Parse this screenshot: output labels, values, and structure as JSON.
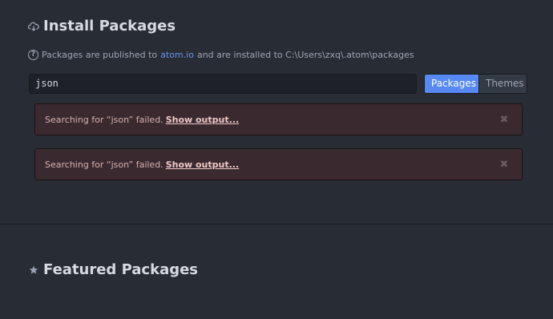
{
  "install": {
    "title": "Install Packages",
    "title_icon": "cloud-download-icon",
    "info_prefix": "Packages are published to",
    "info_link": "atom.io",
    "info_suffix": "and are installed to C:\\Users\\zxq\\.atom\\packages",
    "search_value": "json",
    "buttons": {
      "packages": "Packages",
      "themes": "Themes"
    },
    "alerts": [
      {
        "message": "Searching for “json” failed.",
        "action": "Show output..."
      },
      {
        "message": "Searching for “json” failed.",
        "action": "Show output..."
      }
    ]
  },
  "featured": {
    "title": "Featured Packages",
    "title_icon": "star-icon"
  },
  "colors": {
    "background": "#282c34",
    "accent": "#568af2",
    "link": "#6494ed",
    "error_bg": "#3a2a2f"
  }
}
